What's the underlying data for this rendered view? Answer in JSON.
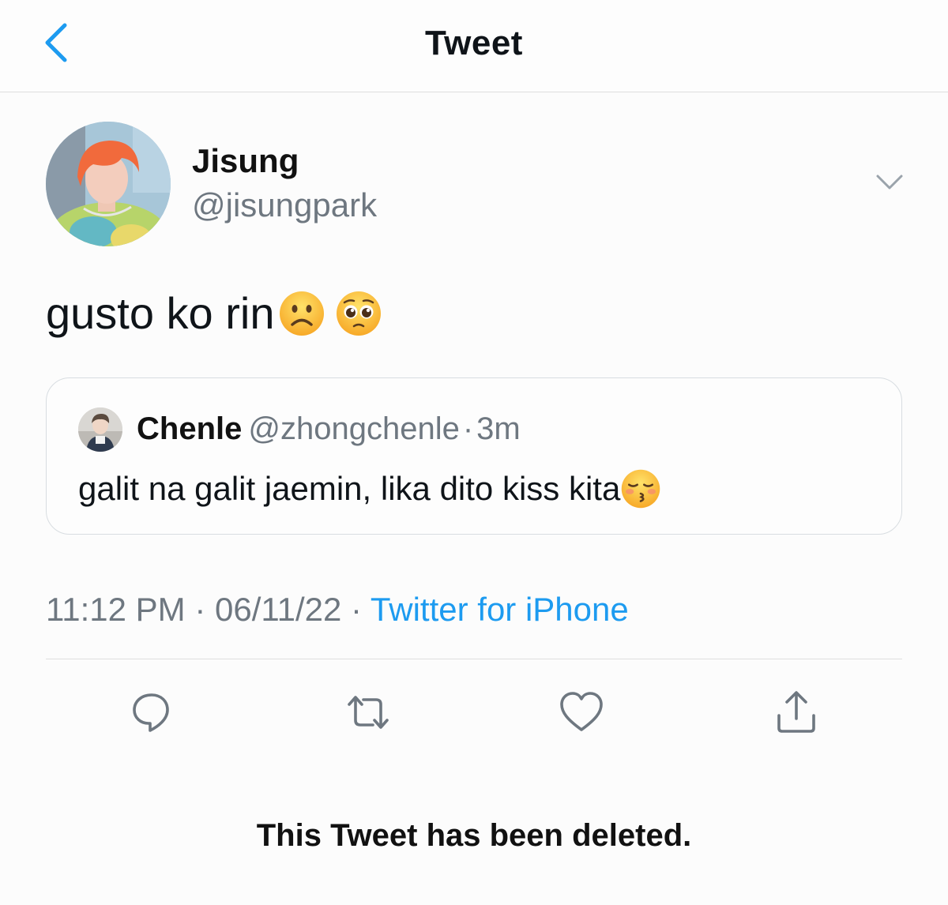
{
  "header": {
    "title": "Tweet",
    "back_icon": "chevron-left-icon"
  },
  "tweet": {
    "author_name": "Jisung",
    "author_handle": "@jisungpark",
    "text": "gusto ko rin",
    "emojis": [
      "frowning-face-emoji",
      "pleading-face-emoji"
    ],
    "timestamp": "11:12 PM · 06/11/22 · ",
    "source": "Twitter for iPhone"
  },
  "quoted": {
    "author_name": "Chenle",
    "author_handle": "@zhongchenle",
    "separator": "·",
    "time": "3m",
    "text": "galit na galit jaemin, lika dito kiss kita",
    "emoji": "kissing-closed-eyes-emoji"
  },
  "actions": [
    "reply-icon",
    "retweet-icon",
    "like-icon",
    "share-icon"
  ],
  "notice": "This Tweet has been deleted.",
  "colors": {
    "accent": "#1d9bf0",
    "secondary_text": "#6e7780",
    "primary_text": "#0f1419",
    "border": "#d8dde1"
  }
}
